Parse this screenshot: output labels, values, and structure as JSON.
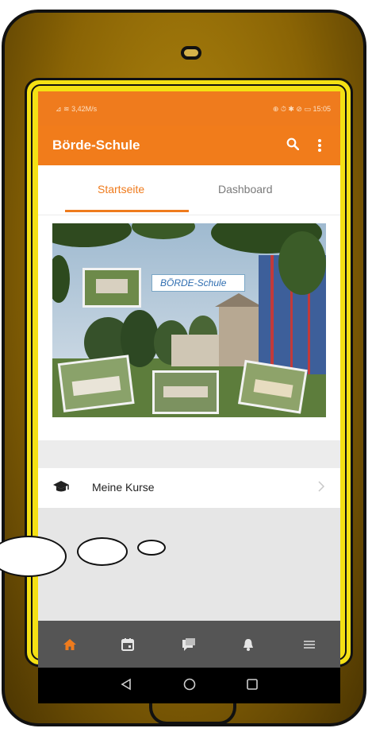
{
  "status_bar": {
    "left_text": "⊿ ≋ 3,42M/s",
    "right_text": "⊕ ⏱ ✱ ⊘ ▭ 15:05"
  },
  "app_bar": {
    "title": "Börde-Schule",
    "search_icon": "search-icon",
    "menu_icon": "more-vertical-icon"
  },
  "tabs": [
    {
      "label": "Startseite",
      "active": true
    },
    {
      "label": "Dashboard",
      "active": false
    }
  ],
  "banner": {
    "sign_text": "BÖRDE-Schule"
  },
  "list": [
    {
      "label": "Meine Kurse",
      "icon": "graduation-cap-icon"
    }
  ],
  "bottom_nav": [
    {
      "icon": "home-icon",
      "active": true
    },
    {
      "icon": "calendar-icon",
      "active": false
    },
    {
      "icon": "messages-icon",
      "active": false
    },
    {
      "icon": "bell-icon",
      "active": false
    },
    {
      "icon": "hamburger-menu-icon",
      "active": false
    }
  ],
  "system_nav": [
    "back-icon",
    "home-circle-icon",
    "recents-icon"
  ],
  "colors": {
    "accent": "#ef7b1d",
    "bezel": "#f4e014",
    "frame": "#8a6405",
    "nav_bg": "#555555"
  }
}
